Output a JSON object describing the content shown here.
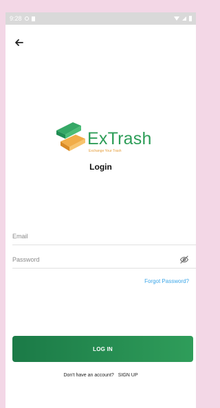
{
  "status": {
    "time": "9:28"
  },
  "app": {
    "brand": "ExTrash",
    "tagline": "Exchange Your Trash",
    "title": "Login"
  },
  "form": {
    "email_placeholder": "Email",
    "password_placeholder": "Password",
    "forgot_label": "Forgot Password?",
    "login_label": "LOG IN",
    "signup_prompt": "Don't have an account?",
    "signup_label": "SIGN UP"
  },
  "colors": {
    "background": "#f3d7e6",
    "brand_green": "#2d9d58",
    "brand_orange": "#e59d3a",
    "link_blue": "#3ba6e8",
    "button_start": "#1b7a47",
    "button_end": "#2f9d5a"
  },
  "icons": {
    "back": "arrow-left-icon",
    "password_visibility": "eye-off-icon"
  }
}
